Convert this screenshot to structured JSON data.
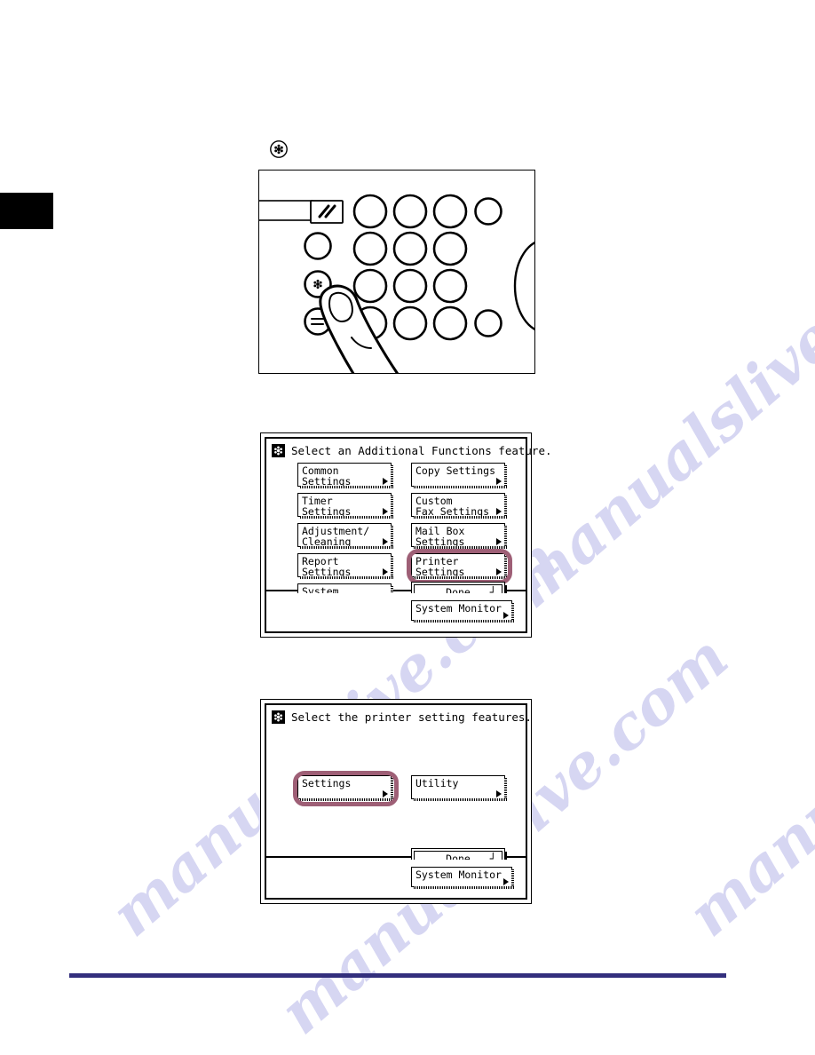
{
  "page": {
    "watermark_text": "manualslive.com",
    "accent_color": "#9e5f76",
    "footer_rule_color": "#332f7d"
  },
  "step_marker": {
    "icon": "additional-functions-key-icon"
  },
  "illustration": {
    "name": "control-panel-photo",
    "description": "Finger pressing the Additional Functions key on the operation panel"
  },
  "screen1": {
    "icon": "additional-functions-icon",
    "header": "Select an Additional Functions feature.",
    "buttons_left": [
      {
        "label": "Common Settings",
        "label2": "",
        "selected": false
      },
      {
        "label": "Timer Settings",
        "label2": "",
        "selected": false
      },
      {
        "label": "Adjustment/",
        "label2": "Cleaning",
        "selected": false
      },
      {
        "label": "Report Settings",
        "label2": "",
        "selected": false
      },
      {
        "label": "System Settings",
        "label2": "",
        "selected": false
      }
    ],
    "buttons_right": [
      {
        "label": "Copy Settings",
        "label2": "",
        "selected": false
      },
      {
        "label": "Custom",
        "label2": "Fax Settings",
        "selected": false
      },
      {
        "label": "Mail Box Settings",
        "label2": "",
        "selected": false
      },
      {
        "label": "Printer Settings",
        "label2": "",
        "selected": true
      }
    ],
    "done_label": "Done",
    "done_glyph": "┘",
    "system_monitor_label": "System Monitor"
  },
  "screen2": {
    "icon": "additional-functions-icon",
    "header": "Select the printer setting features.",
    "buttons": [
      {
        "label": "Settings",
        "selected": true
      },
      {
        "label": "Utility",
        "selected": false
      }
    ],
    "done_label": "Done",
    "done_glyph": "┘",
    "system_monitor_label": "System Monitor"
  }
}
